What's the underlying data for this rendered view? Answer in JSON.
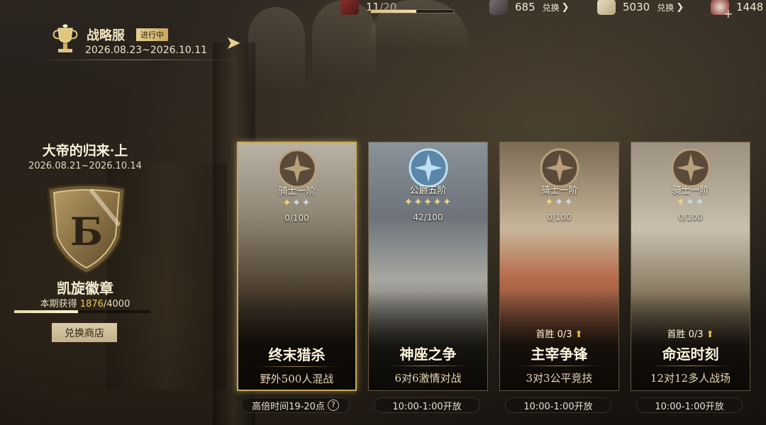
{
  "resources": {
    "stamina": {
      "value": "11",
      "max": "/20",
      "progress": 0.55
    },
    "currency1": {
      "amount": "685",
      "exchange_label": "兑换",
      "icon": "ore-chest-icon"
    },
    "currency2": {
      "amount": "5030",
      "exchange_label": "兑换",
      "icon": "scroll-icon"
    },
    "currency3": {
      "amount": "1448",
      "icon": "cup-icon"
    }
  },
  "season": {
    "name": "战略服",
    "status": "进行中",
    "dates": "2026.08.23~2026.10.11"
  },
  "badge": {
    "event_title": "大帝的归来·上",
    "event_dates": "2026.08.21~2026.10.14",
    "letter": "Б",
    "name": "凯旋徽章",
    "earned_label": "本期获得 ",
    "current": "1876",
    "max": "/4000",
    "progress": 0.469,
    "shop_button": "兑换商店"
  },
  "modes": [
    {
      "rank": "骑士一阶",
      "stars_on": 1,
      "stars_total": 3,
      "progress": "0/100",
      "first_win": "",
      "title": "终末猎杀",
      "subtitle": "野外500人混战",
      "schedule": "高倍时间19-20点",
      "selected": true,
      "help_icon": "?"
    },
    {
      "rank": "公爵五阶",
      "stars_on": 5,
      "stars_total": 5,
      "progress": "42/100",
      "first_win": "",
      "title": "神座之争",
      "subtitle": "6对6激情对战",
      "schedule": "10:00-1:00开放",
      "selected": false
    },
    {
      "rank": "骑士一阶",
      "stars_on": 1,
      "stars_total": 3,
      "progress": "0/100",
      "first_win": "首胜 0/3",
      "title": "主宰争锋",
      "subtitle": "3对3公平竞技",
      "schedule": "10:00-1:00开放",
      "selected": false
    },
    {
      "rank": "骑士一阶",
      "stars_on": 1,
      "stars_total": 3,
      "progress": "0/100",
      "first_win": "首胜 0/3",
      "title": "命运时刻",
      "subtitle": "12对12多人战场",
      "schedule": "10:00-1:00开放",
      "selected": false
    }
  ],
  "colors": {
    "accent_gold": "#c9a75d",
    "highlight": "#f0c85a"
  }
}
